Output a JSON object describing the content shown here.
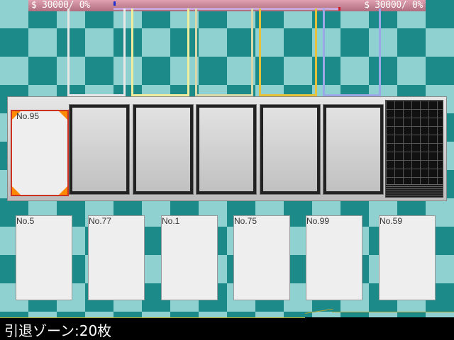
{
  "status_bar": {
    "player_money": "$ 30000/  0%",
    "opponent_money": "$ 30000/  0%"
  },
  "opponent_slots": [
    {
      "border_color": "#e8e8e8"
    },
    {
      "border_color": "#f0ee9a"
    },
    {
      "border_color": "#d8d8a8"
    },
    {
      "border_color": "#e6c23a"
    },
    {
      "border_color": "#9aa8e8"
    }
  ],
  "field": {
    "active_card": {
      "label": "No.95"
    },
    "empty_slots": 5
  },
  "hand": [
    {
      "label": "No.5"
    },
    {
      "label": "No.77"
    },
    {
      "label": "No.1"
    },
    {
      "label": "No.75"
    },
    {
      "label": "No.99"
    },
    {
      "label": "No.59"
    }
  ],
  "bottom_bar": {
    "retire_zone": "引退ゾーン:20枚"
  }
}
